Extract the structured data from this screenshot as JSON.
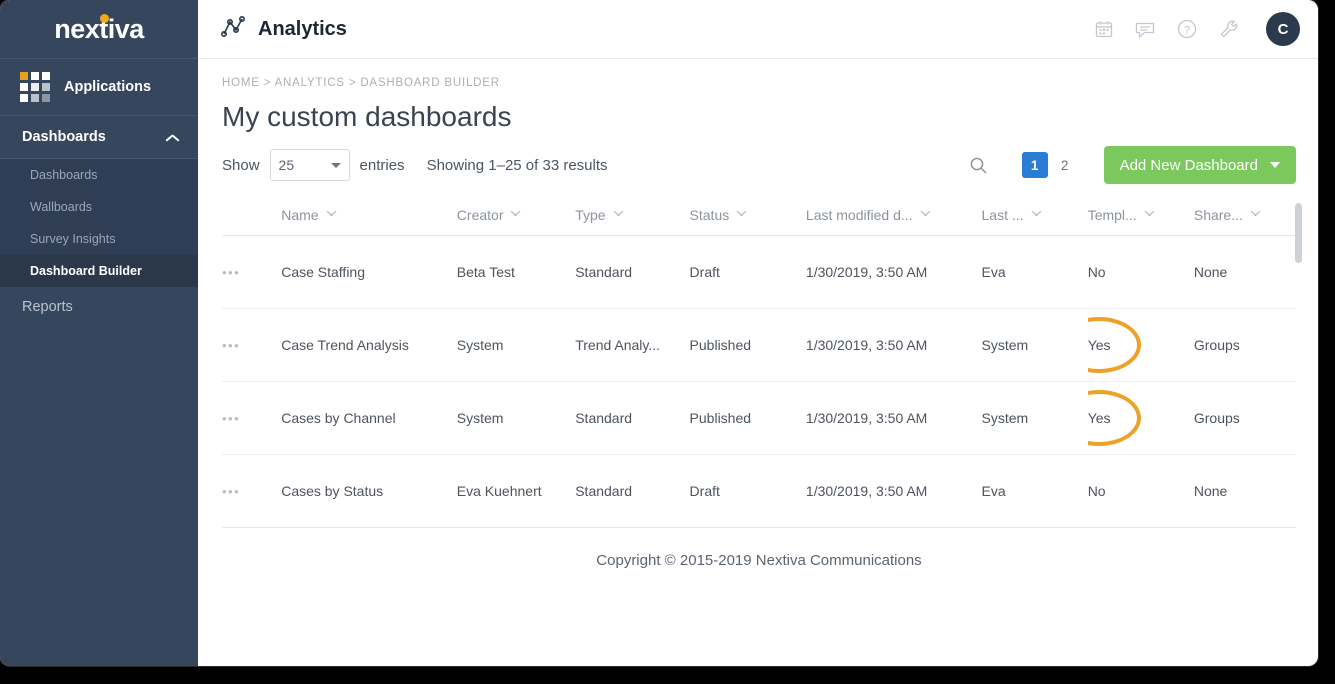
{
  "brand": {
    "logo_text": "nextiva",
    "accent": "#f3a81c"
  },
  "sidebar": {
    "applications_label": "Applications",
    "section": {
      "label": "Dashboards",
      "icon": "chevron-up-icon"
    },
    "sub_items": [
      {
        "label": "Dashboards",
        "active": false
      },
      {
        "label": "Wallboards",
        "active": false
      },
      {
        "label": "Survey Insights",
        "active": false
      },
      {
        "label": "Dashboard Builder",
        "active": true
      }
    ],
    "reports_label": "Reports"
  },
  "topbar": {
    "app_title": "Analytics",
    "app_icon": "line-chart-icon",
    "icons": [
      "calendar-icon",
      "chat-icon",
      "help-icon",
      "wrench-icon"
    ],
    "avatar_initial": "C"
  },
  "breadcrumb": "HOME > ANALYTICS > DASHBOARD BUILDER",
  "page_title": "My custom dashboards",
  "toolbar": {
    "show_label": "Show",
    "entries_value": "25",
    "entries_label": "entries",
    "showing_text": "Showing 1–25 of 33 results",
    "search_icon": "search-icon",
    "pagination": [
      {
        "label": "1",
        "current": true
      },
      {
        "label": "2",
        "current": false
      }
    ],
    "add_button_label": "Add New Dashboard",
    "add_button_color": "#7bc95d"
  },
  "table": {
    "columns": [
      {
        "key": "actions",
        "label": ""
      },
      {
        "key": "name",
        "label": "Name"
      },
      {
        "key": "creator",
        "label": "Creator"
      },
      {
        "key": "type",
        "label": "Type"
      },
      {
        "key": "status",
        "label": "Status"
      },
      {
        "key": "last_modified_date",
        "label": "Last modified d..."
      },
      {
        "key": "last_modified_by",
        "label": "Last ..."
      },
      {
        "key": "template",
        "label": "Templ..."
      },
      {
        "key": "shared",
        "label": "Share..."
      }
    ],
    "rows": [
      {
        "actions": "•••",
        "name": "Case Staffing",
        "creator": "Beta Test",
        "type": "Standard",
        "status": "Draft",
        "last_modified_date": "1/30/2019, 3:50 AM",
        "last_modified_by": "Eva",
        "template": "No",
        "shared": "None",
        "template_highlighted": false
      },
      {
        "actions": "•••",
        "name": "Case Trend Analysis",
        "creator": "System",
        "type": "Trend Analy...",
        "status": "Published",
        "last_modified_date": "1/30/2019, 3:50 AM",
        "last_modified_by": "System",
        "template": "Yes",
        "shared": "Groups",
        "template_highlighted": true
      },
      {
        "actions": "•••",
        "name": "Cases by Channel",
        "creator": "System",
        "type": "Standard",
        "status": "Published",
        "last_modified_date": "1/30/2019, 3:50 AM",
        "last_modified_by": "System",
        "template": "Yes",
        "shared": "Groups",
        "template_highlighted": true
      },
      {
        "actions": "•••",
        "name": "Cases by Status",
        "creator": "Eva Kuehnert",
        "type": "Standard",
        "status": "Draft",
        "last_modified_date": "1/30/2019, 3:50 AM",
        "last_modified_by": "Eva",
        "template": "No",
        "shared": "None",
        "template_highlighted": false
      }
    ],
    "annotation_color": "#eda227"
  },
  "footer": "Copyright © 2015-2019 Nextiva Communications"
}
